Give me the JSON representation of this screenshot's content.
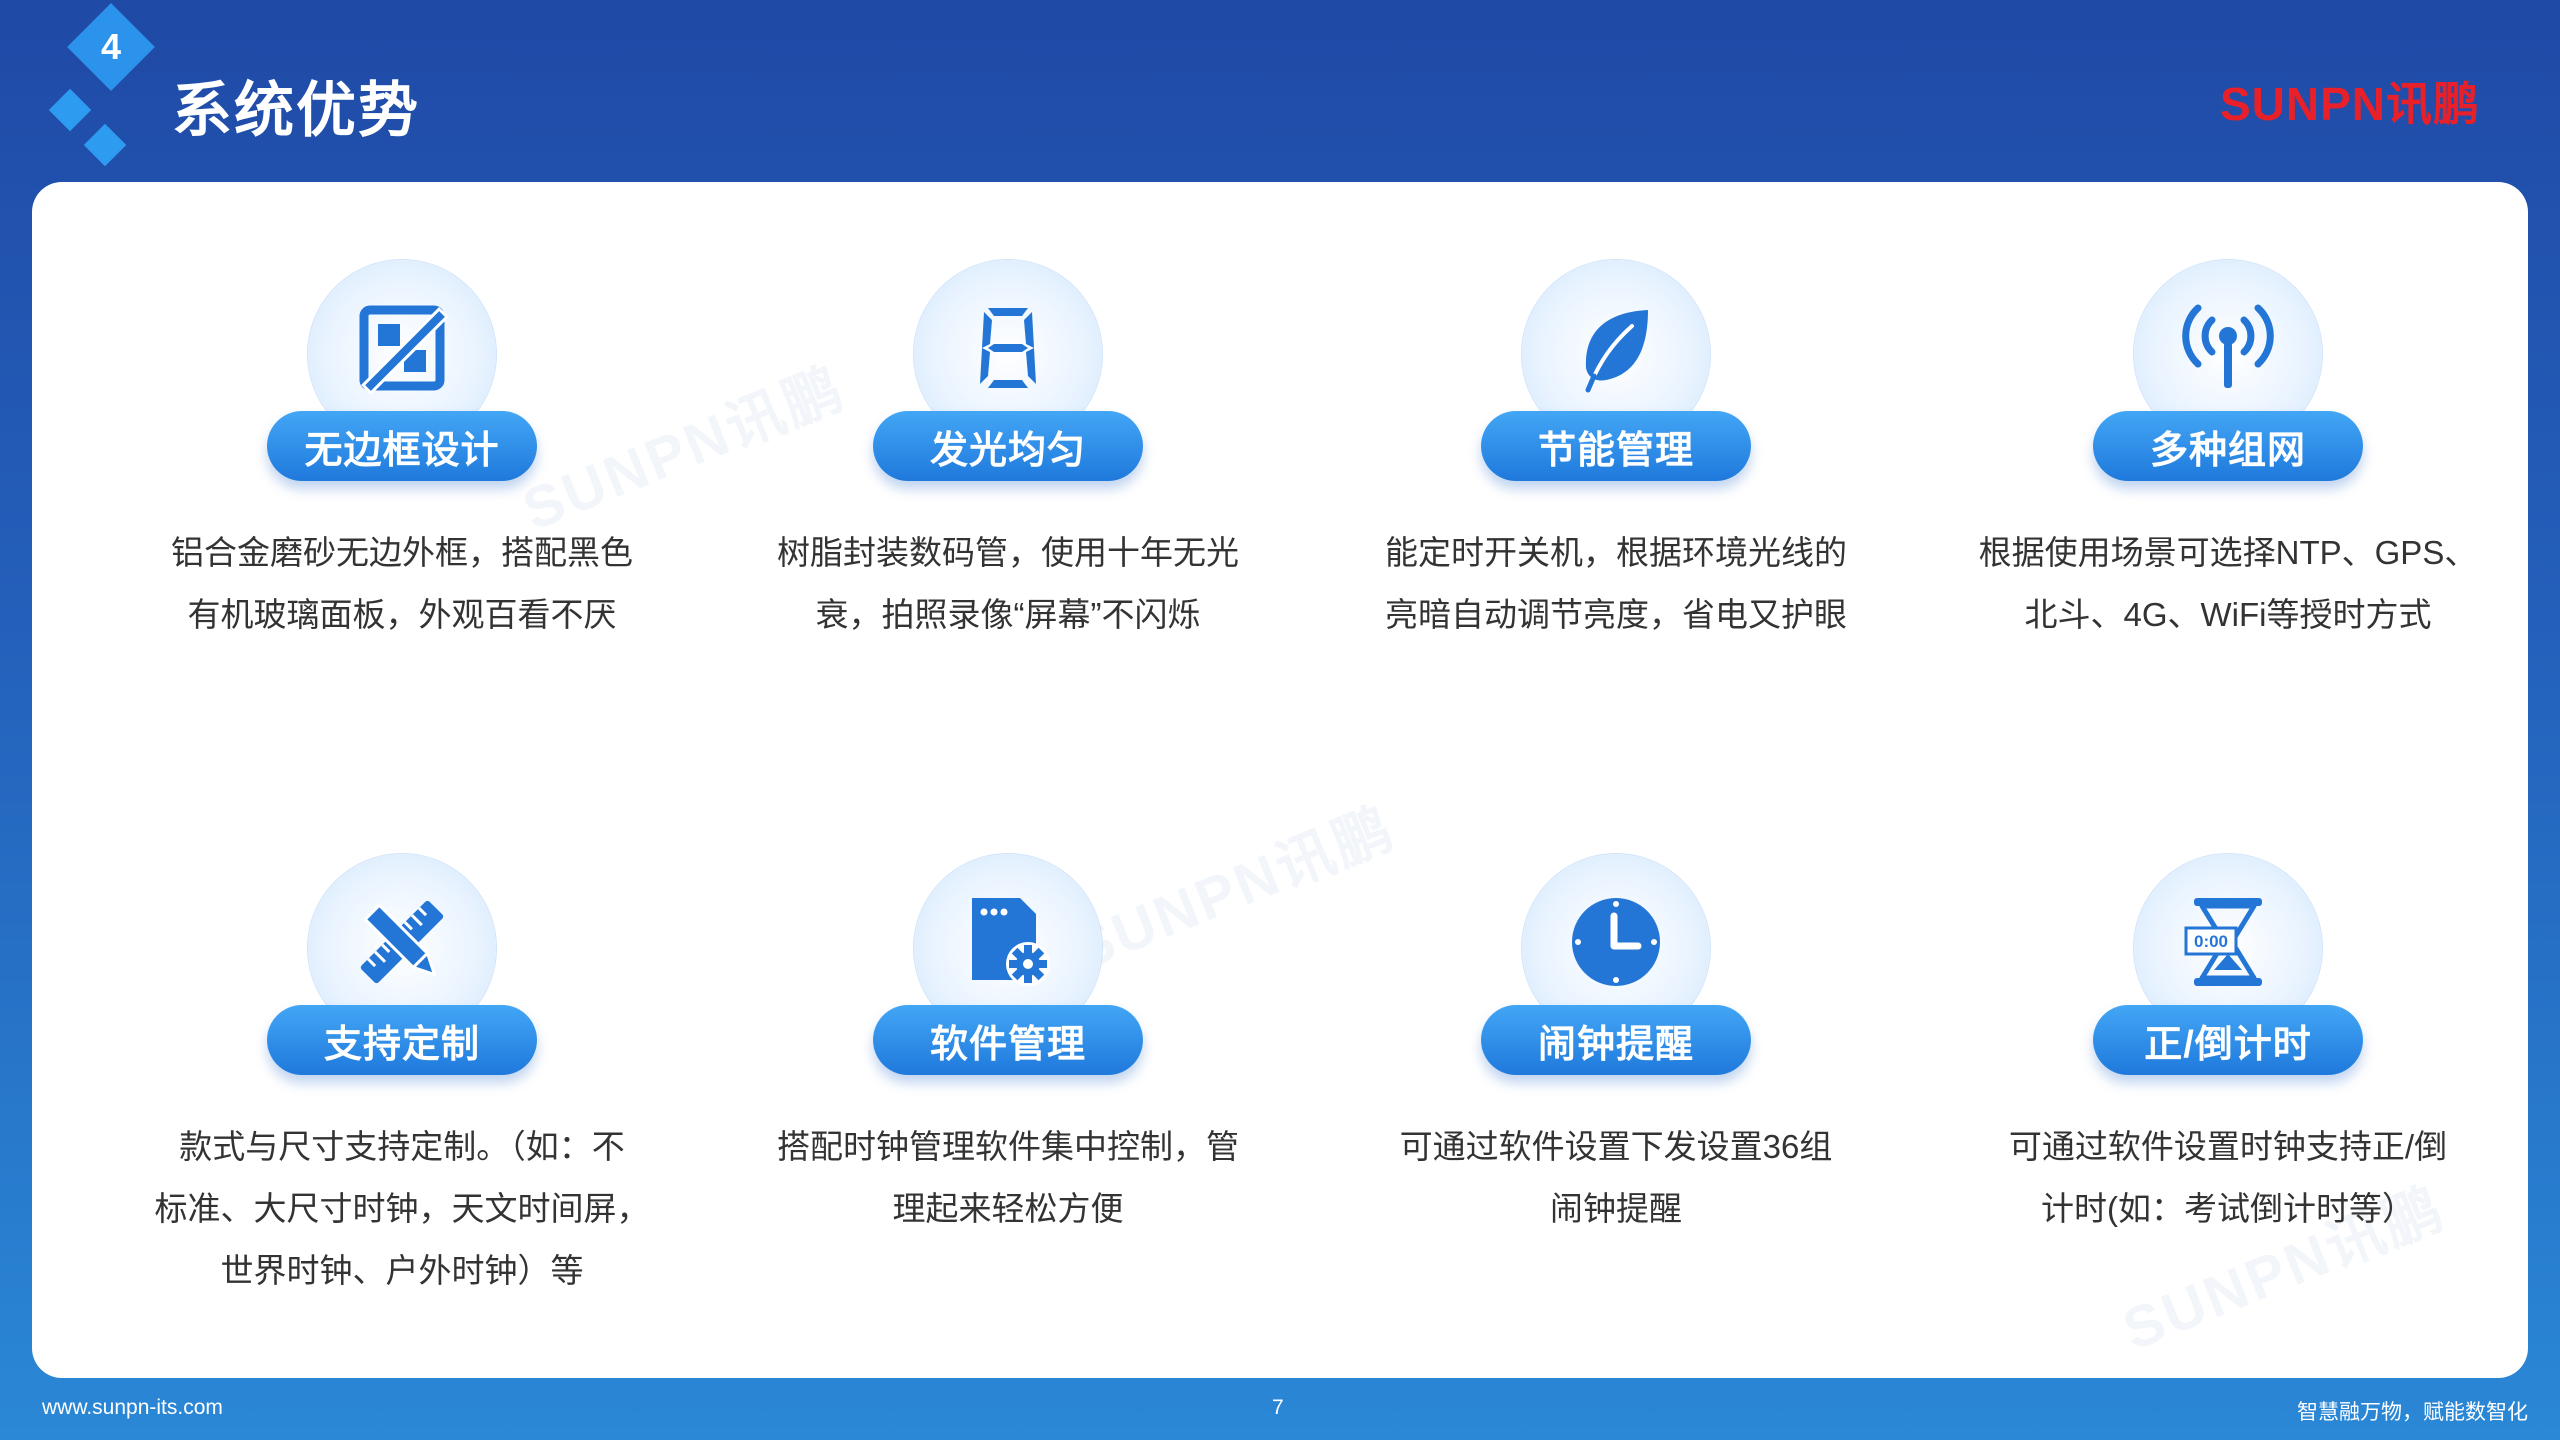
{
  "header": {
    "section_number": "4",
    "title": "系统优势",
    "brand": "SUNPN讯鹏"
  },
  "colors": {
    "background_top": "#1f4aa6",
    "background_bottom": "#2a88d6",
    "accent_blue": "#2c93ec",
    "pill_blue": "#2b8be6",
    "brand_red": "#e8202a"
  },
  "watermarks": [
    "SUNPN讯鹏",
    "SUNPN讯鹏",
    "SUNPN讯鹏"
  ],
  "features": [
    {
      "icon": "frameless-icon",
      "title": "无边框设计",
      "lines": [
        "铝合金磨砂无边外框，搭配黑色",
        "有机玻璃面板，外观百看不厌"
      ]
    },
    {
      "icon": "digit-eight-icon",
      "title": "发光均匀",
      "lines": [
        "树脂封装数码管，使用十年无光",
        "衰，拍照录像“屏幕”不闪烁"
      ]
    },
    {
      "icon": "leaf-icon",
      "title": "节能管理",
      "lines": [
        "能定时开关机，根据环境光线的",
        "亮暗自动调节亮度，省电又护眼"
      ]
    },
    {
      "icon": "antenna-signal-icon",
      "title": "多种组网",
      "lines": [
        "根据使用场景可选择NTP、GPS、",
        "北斗、4G、WiFi等授时方式"
      ]
    },
    {
      "icon": "pencil-ruler-icon",
      "title": "支持定制",
      "lines": [
        "款式与尺寸支持定制。（如：不",
        "标准、大尺寸时钟，天文时间屏，",
        "世界时钟、户外时钟）等"
      ]
    },
    {
      "icon": "file-gear-icon",
      "title": "软件管理",
      "lines": [
        "搭配时钟管理软件集中控制，管",
        "理起来轻松方便"
      ]
    },
    {
      "icon": "clock-icon",
      "title": "闹钟提醒",
      "lines": [
        "可通过软件设置下发设置36组",
        "闹钟提醒"
      ]
    },
    {
      "icon": "hourglass-timer-icon",
      "title": "正/倒计时",
      "icon_text": "0:00",
      "lines": [
        "可通过软件设置时钟支持正/倒",
        "计时(如：考试倒计时等）"
      ]
    }
  ],
  "footer": {
    "website": "www.sunpn-its.com",
    "page_number": "7",
    "slogan": "智慧融万物，赋能数智化"
  }
}
